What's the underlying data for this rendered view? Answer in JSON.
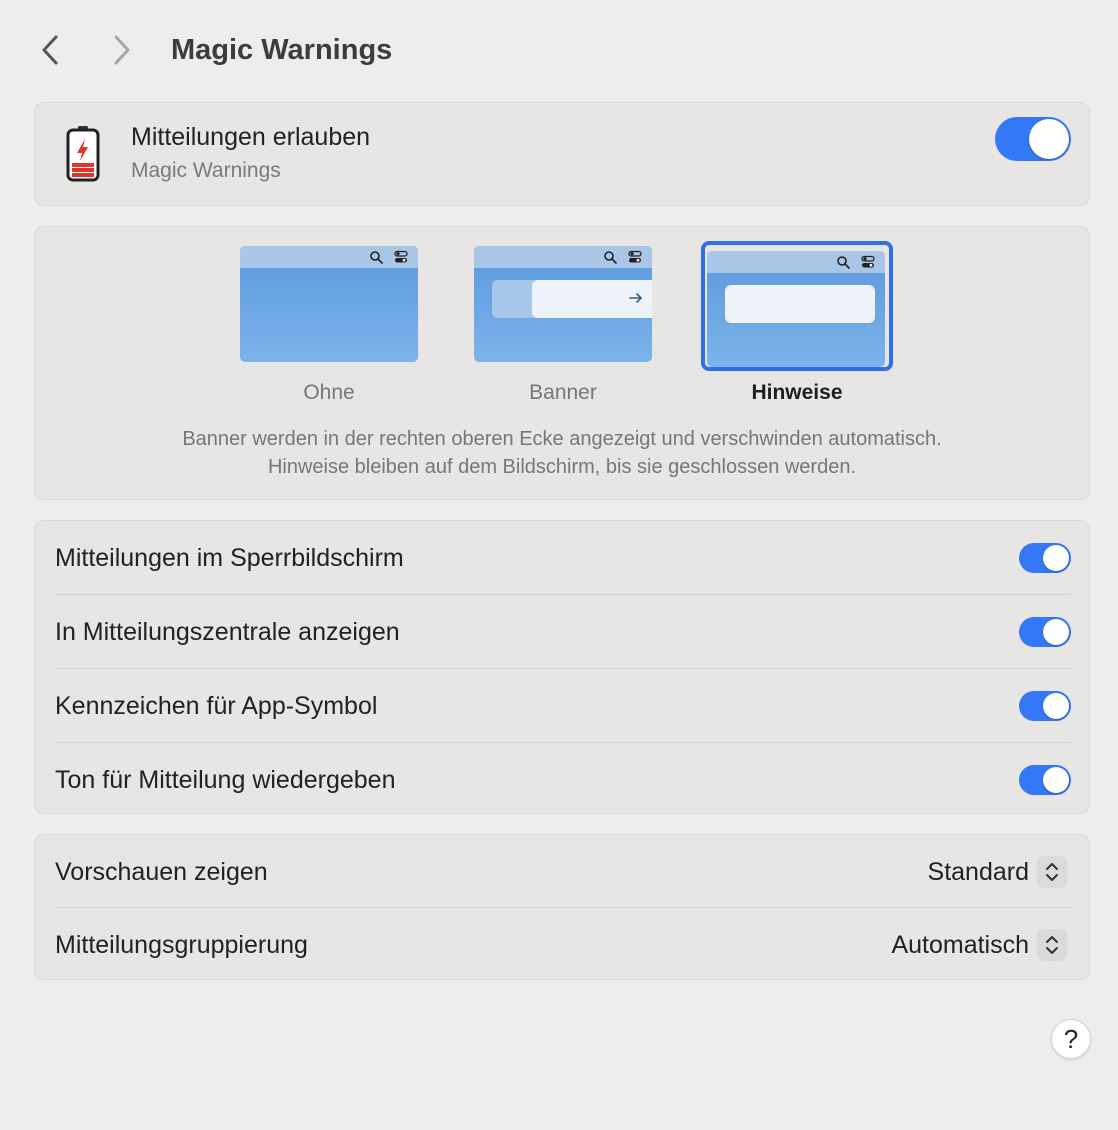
{
  "header": {
    "title": "Magic Warnings",
    "back_icon": "chevron-left-icon",
    "forward_icon": "chevron-right-icon"
  },
  "allow": {
    "title": "Mitteilungen erlauben",
    "subtitle": "Magic Warnings",
    "app_icon": "battery-warning-icon",
    "enabled": true
  },
  "style": {
    "options": [
      {
        "label": "Ohne",
        "selected": false
      },
      {
        "label": "Banner",
        "selected": false
      },
      {
        "label": "Hinweise",
        "selected": true
      }
    ],
    "description_line1": "Banner werden in der rechten oberen Ecke angezeigt und verschwinden automatisch.",
    "description_line2": "Hinweise bleiben auf dem Bildschirm, bis sie geschlossen werden."
  },
  "toggles": [
    {
      "label": "Mitteilungen im Sperrbildschirm",
      "enabled": true
    },
    {
      "label": "In Mitteilungszentrale anzeigen",
      "enabled": true
    },
    {
      "label": "Kennzeichen für App-Symbol",
      "enabled": true
    },
    {
      "label": "Ton für Mitteilung wiedergeben",
      "enabled": true
    }
  ],
  "selects": [
    {
      "label": "Vorschauen zeigen",
      "value": "Standard"
    },
    {
      "label": "Mitteilungsgruppierung",
      "value": "Automatisch"
    }
  ],
  "help": {
    "label": "?"
  },
  "colors": {
    "accent": "#3478f6",
    "background": "#efedeb",
    "card": "#e8e6e4",
    "battery_red": "#e0352b"
  }
}
